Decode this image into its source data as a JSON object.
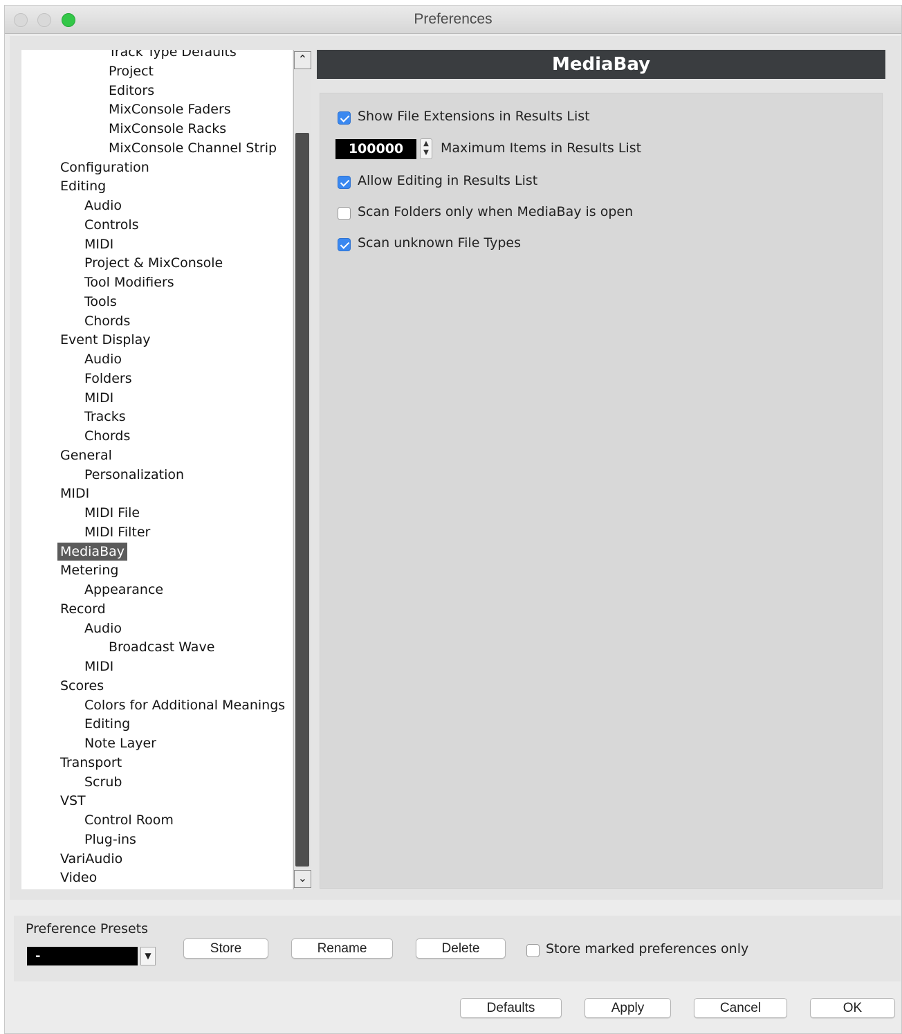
{
  "window": {
    "title": "Preferences"
  },
  "tree": {
    "items": [
      {
        "label": "Track Type Defaults",
        "level": 3
      },
      {
        "label": "Project",
        "level": 3
      },
      {
        "label": "Editors",
        "level": 3
      },
      {
        "label": "MixConsole Faders",
        "level": 3
      },
      {
        "label": "MixConsole Racks",
        "level": 3
      },
      {
        "label": "MixConsole Channel Strip",
        "level": 3
      },
      {
        "label": "Configuration",
        "level": 1
      },
      {
        "label": "Editing",
        "level": 1
      },
      {
        "label": "Audio",
        "level": 2
      },
      {
        "label": "Controls",
        "level": 2
      },
      {
        "label": "MIDI",
        "level": 2
      },
      {
        "label": "Project & MixConsole",
        "level": 2
      },
      {
        "label": "Tool Modifiers",
        "level": 2
      },
      {
        "label": "Tools",
        "level": 2
      },
      {
        "label": "Chords",
        "level": 2
      },
      {
        "label": "Event Display",
        "level": 1
      },
      {
        "label": "Audio",
        "level": 2
      },
      {
        "label": "Folders",
        "level": 2
      },
      {
        "label": "MIDI",
        "level": 2
      },
      {
        "label": "Tracks",
        "level": 2
      },
      {
        "label": "Chords",
        "level": 2
      },
      {
        "label": "General",
        "level": 1
      },
      {
        "label": "Personalization",
        "level": 2
      },
      {
        "label": "MIDI",
        "level": 1
      },
      {
        "label": "MIDI File",
        "level": 2
      },
      {
        "label": "MIDI Filter",
        "level": 2
      },
      {
        "label": "MediaBay",
        "level": 1,
        "selected": true
      },
      {
        "label": "Metering",
        "level": 1
      },
      {
        "label": "Appearance",
        "level": 2
      },
      {
        "label": "Record",
        "level": 1
      },
      {
        "label": "Audio",
        "level": 2
      },
      {
        "label": "Broadcast Wave",
        "level": 3
      },
      {
        "label": "MIDI",
        "level": 2
      },
      {
        "label": "Scores",
        "level": 1
      },
      {
        "label": "Colors for Additional Meanings",
        "level": 2
      },
      {
        "label": "Editing",
        "level": 2
      },
      {
        "label": "Note Layer",
        "level": 2
      },
      {
        "label": "Transport",
        "level": 1
      },
      {
        "label": "Scrub",
        "level": 2
      },
      {
        "label": "VST",
        "level": 1
      },
      {
        "label": "Control Room",
        "level": 2
      },
      {
        "label": "Plug-ins",
        "level": 2
      },
      {
        "label": "VariAudio",
        "level": 1
      },
      {
        "label": "Video",
        "level": 1
      }
    ]
  },
  "panel": {
    "title": "MediaBay",
    "options": {
      "show_extensions": {
        "label": "Show File Extensions in Results List",
        "checked": true
      },
      "max_items": {
        "label": "Maximum Items in Results List",
        "value": "100000"
      },
      "allow_editing": {
        "label": "Allow Editing in Results List",
        "checked": true
      },
      "scan_folders_only": {
        "label": "Scan Folders only when MediaBay is open",
        "checked": false
      },
      "scan_unknown": {
        "label": "Scan unknown File Types",
        "checked": true
      }
    }
  },
  "presets": {
    "label": "Preference Presets",
    "selected_value": "-",
    "store_label": "Store",
    "rename_label": "Rename",
    "delete_label": "Delete",
    "store_marked_label": "Store marked preferences only",
    "store_marked_checked": false
  },
  "footer": {
    "defaults_label": "Defaults",
    "apply_label": "Apply",
    "cancel_label": "Cancel",
    "ok_label": "OK"
  }
}
